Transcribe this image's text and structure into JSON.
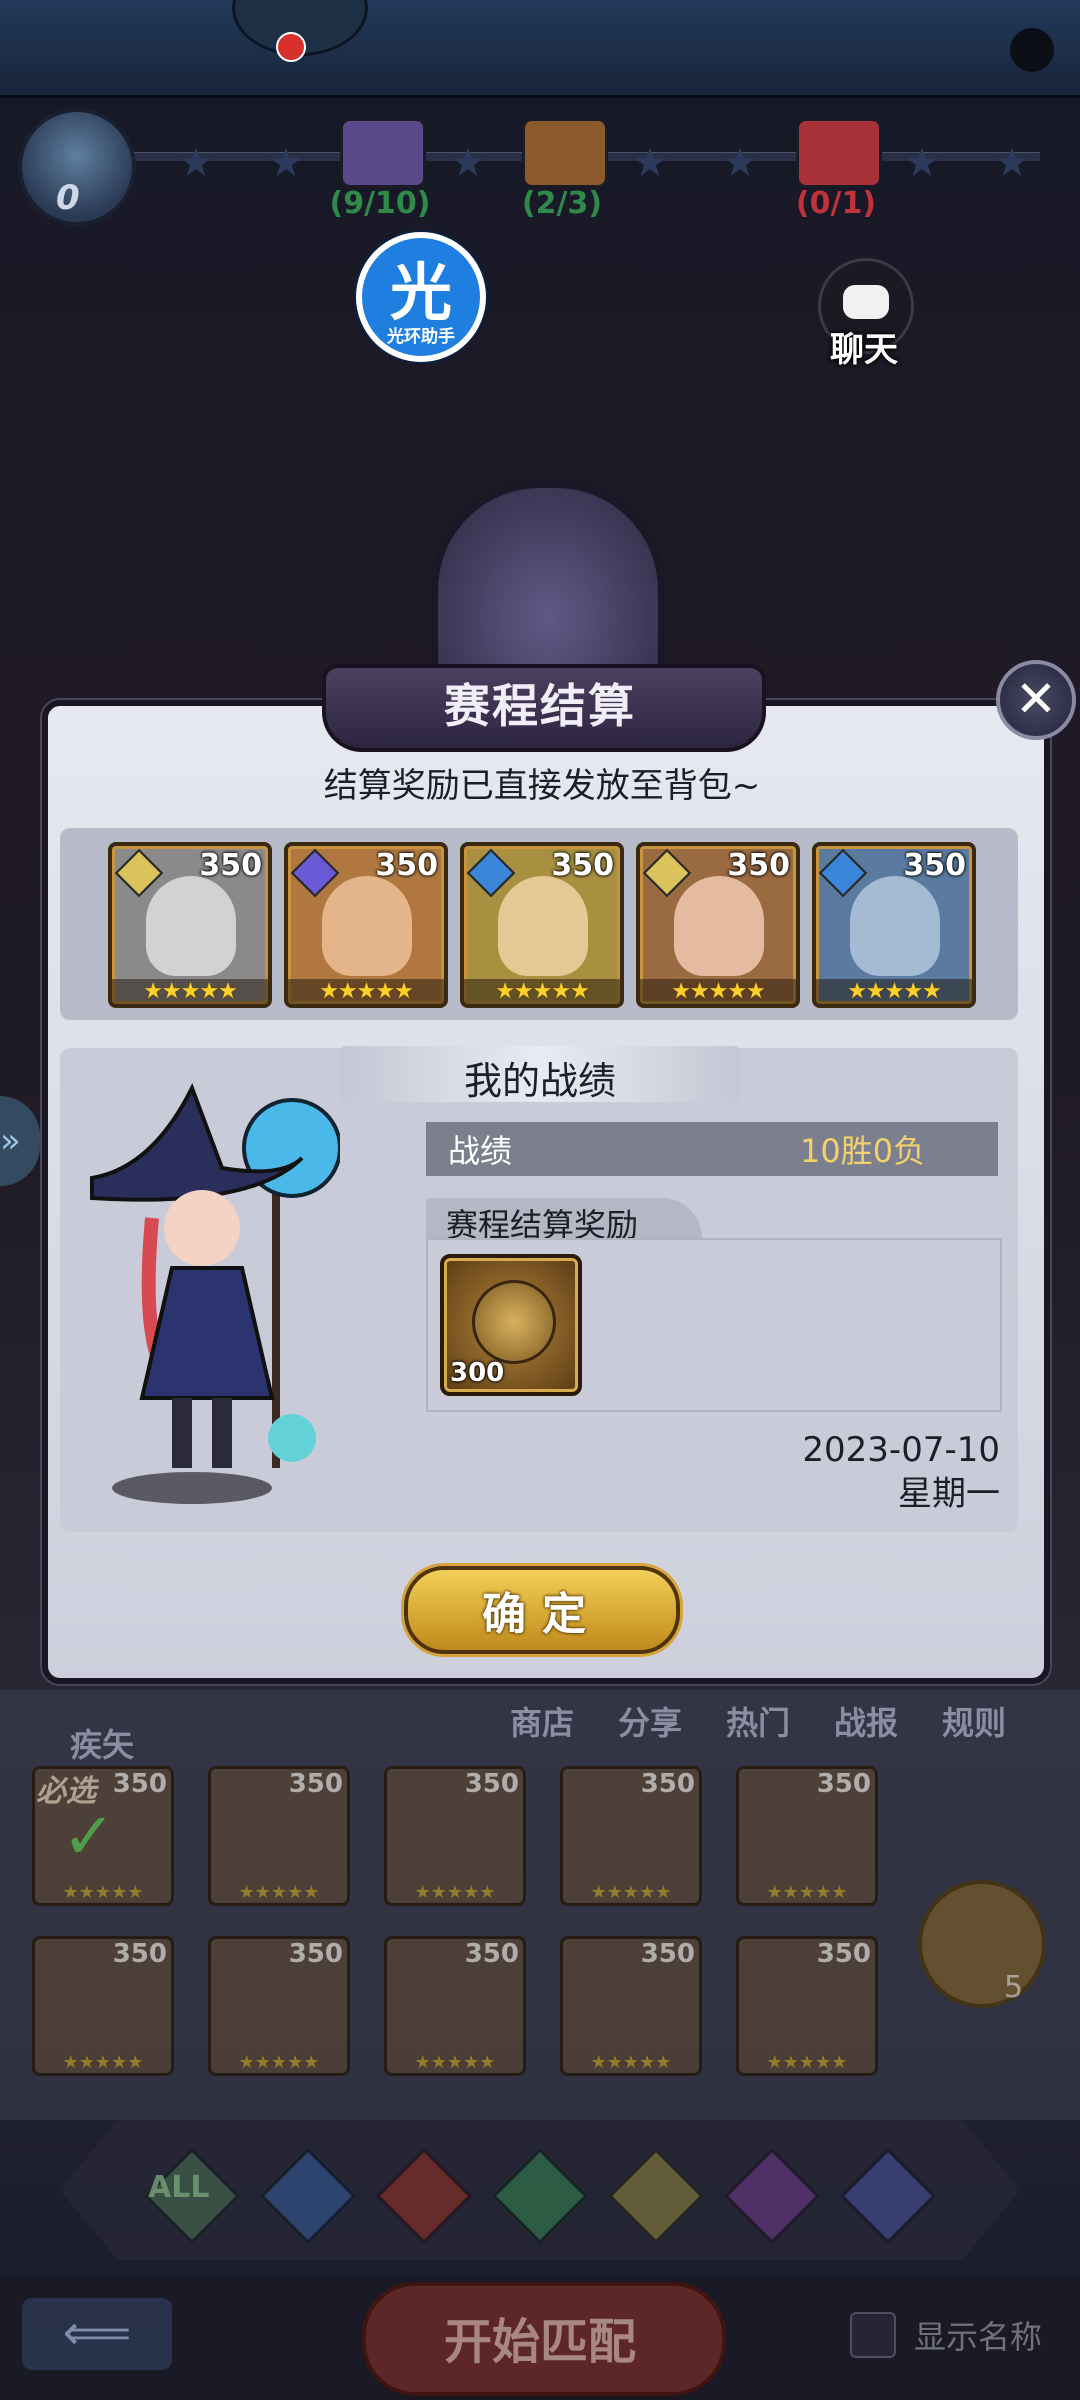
{
  "header": {
    "trophy_count": "0",
    "chests": [
      {
        "progress": "(9/10)",
        "color": "#2f8a4a"
      },
      {
        "progress": "(2/3)",
        "color": "#2f8a4a"
      },
      {
        "progress": "(0/1)",
        "color": "#c0333a"
      }
    ],
    "helper_big": "光",
    "helper_small": "光环助手",
    "chat_label": "聊天"
  },
  "dialog": {
    "title": "赛程结算",
    "subtitle": "结算奖励已直接发放至背包~",
    "heroes": [
      {
        "level": "350",
        "stars": "★★★★★",
        "element": "light"
      },
      {
        "level": "350",
        "stars": "★★★★★",
        "element": "cosmic"
      },
      {
        "level": "350",
        "stars": "★★★★★",
        "element": "water"
      },
      {
        "level": "350",
        "stars": "★★★★★",
        "element": "light"
      },
      {
        "level": "350",
        "stars": "★★★★★",
        "element": "water"
      }
    ],
    "record_title": "我的战绩",
    "stat_label": "战绩",
    "stat_value": "10胜0负",
    "reward_title": "赛程结算奖励",
    "reward_qty": "300",
    "date": "2023-07-10",
    "weekday": "星期一",
    "confirm_label": "确定"
  },
  "lower": {
    "tabs": [
      "疾矢",
      "商店",
      "分享",
      "热门",
      "战报",
      "规则"
    ],
    "must_pick": "必选",
    "card_level": "350",
    "card_stars": "★★★★★",
    "side_token_count": "5",
    "all_label": "ALL",
    "start_label": "开始匹配",
    "show_name_label": "显示名称"
  },
  "colors": {
    "accent_gold": "#f2cf57",
    "stat_value": "#f2d06b",
    "helper_blue": "#1f7fe0"
  }
}
